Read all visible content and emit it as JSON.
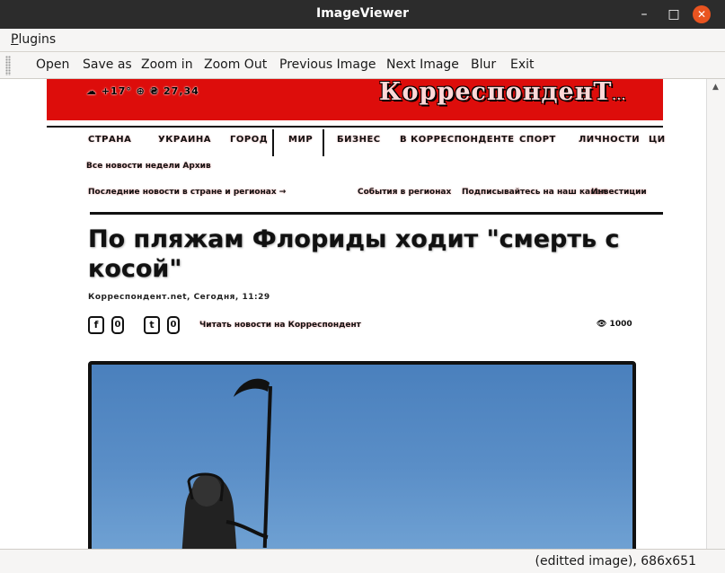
{
  "window": {
    "title": "ImageViewer"
  },
  "titlebar": {
    "minimize": "–",
    "maximize": "□",
    "close": "✕"
  },
  "menubar": {
    "plugins_label_first": "P",
    "plugins_label_rest": "lugins"
  },
  "toolbar": {
    "open": "Open",
    "save_as": "Save as",
    "zoom_in": "Zoom in",
    "zoom_out": "Zoom Out",
    "previous_image": "Previous Image",
    "next_image": "Next Image",
    "blur": "Blur",
    "exit": "Exit"
  },
  "status": {
    "text": "(editted image), 686x651"
  },
  "image": {
    "logo": "КорреспонденТ",
    "logo_suffix": "...",
    "header_info": "☁ +17°  ⊕  ₴ 27,34",
    "nav": [
      "СТРАНА",
      "УКРАИНА",
      "ГОРОД",
      "МИР",
      "БИЗНЕС",
      "В КОРРЕСПОНДЕНТЕ",
      "СПОРТ",
      "ЛИЧНОСТИ",
      "ЦИ"
    ],
    "tagline": "Все новости недели   Архив",
    "links": [
      "Последние новости в стране и регионах →",
      "События в регионах",
      "Подписывайтесь на наш канал",
      "Инвестиции"
    ],
    "headline": "По пляжам Флориды ходит \"смерть с косой\"",
    "byline": "Корреспондент.net, Сегодня, 11:29",
    "share": {
      "fb_icon": "f",
      "fb_count": "0",
      "tw_icon": "t",
      "tw_count": "0",
      "text": "Читать новости на Корреспондент",
      "views": "👁 1000"
    }
  }
}
